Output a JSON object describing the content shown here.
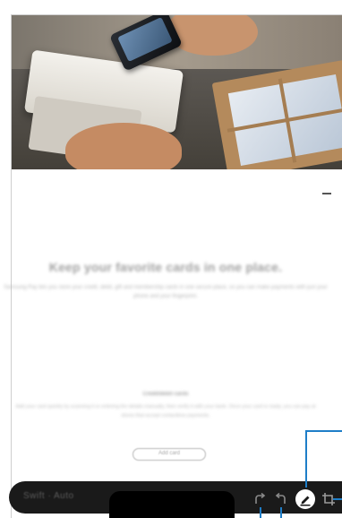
{
  "promo": {
    "title": "Keep your favorite cards in one place.",
    "description": "Samsung Pay lets you store your credit, debit, gift and membership cards in one secure place, so you can make payments with just your phone and your fingerprint."
  },
  "section": {
    "title": "Credit/debit cards",
    "description": "Add your card quickly by scanning it or entering the details manually, then verify it with your bank. Once your card is ready, you can pay at stores that accept contactless payments."
  },
  "pill_button": {
    "label": "Add card"
  },
  "toolbar": {
    "text": "Swift · Auto",
    "redo_icon": "redo-icon",
    "undo_icon": "undo-icon",
    "pen_icon": "pen-icon",
    "crop_icon": "crop-icon"
  },
  "colors": {
    "toolbar_bg": "#1a1a1a",
    "callout": "#1e7ec8",
    "pen_button": "#ffffff"
  }
}
